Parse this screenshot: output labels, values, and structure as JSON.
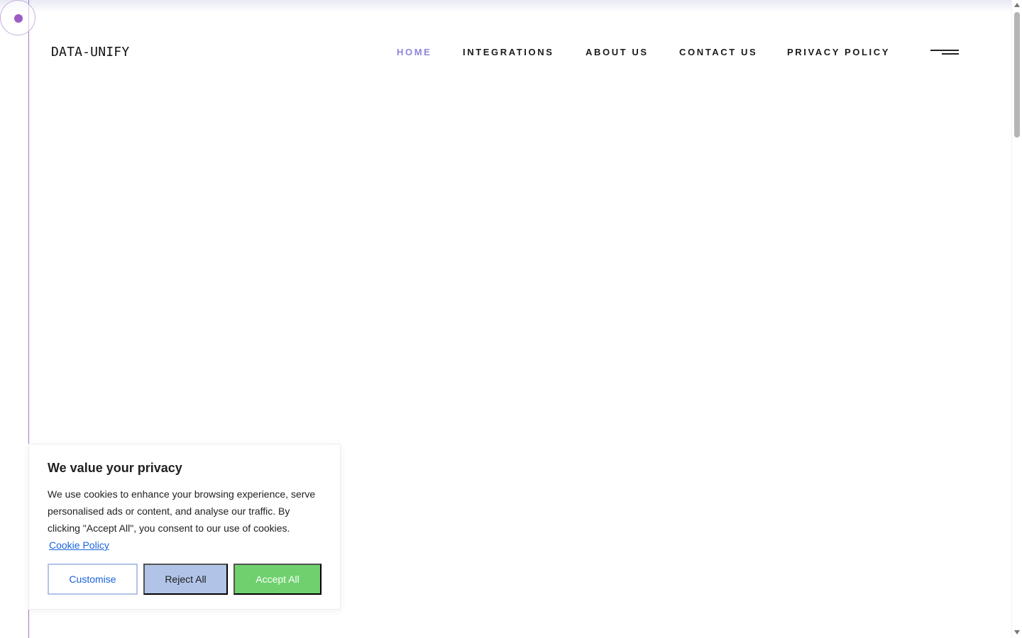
{
  "brand": {
    "logo_text": "DATA-UNIFY"
  },
  "nav": {
    "items": [
      {
        "label": "HOME",
        "active": true
      },
      {
        "label": "INTEGRATIONS",
        "active": false
      },
      {
        "label": "ABOUT US",
        "active": false
      },
      {
        "label": "CONTACT US",
        "active": false
      },
      {
        "label": "PRIVACY POLICY",
        "active": false
      }
    ],
    "menu_icon": "hamburger-menu-icon"
  },
  "cookie_banner": {
    "title": "We value your privacy",
    "text": "We use cookies to enhance your browsing experience, serve personalised ads or content, and analyse our traffic. By clicking \"Accept All\", you consent to our use of cookies.",
    "link_text": "Cookie Policy",
    "buttons": {
      "customise": "Customise",
      "reject": "Reject All",
      "accept": "Accept All"
    }
  },
  "colors": {
    "accent_purple": "#9b5cc4",
    "nav_active": "#8a86d8",
    "link_blue": "#1863dc",
    "reject_bg": "#b1c4e8",
    "accept_bg": "#6ed16e"
  }
}
